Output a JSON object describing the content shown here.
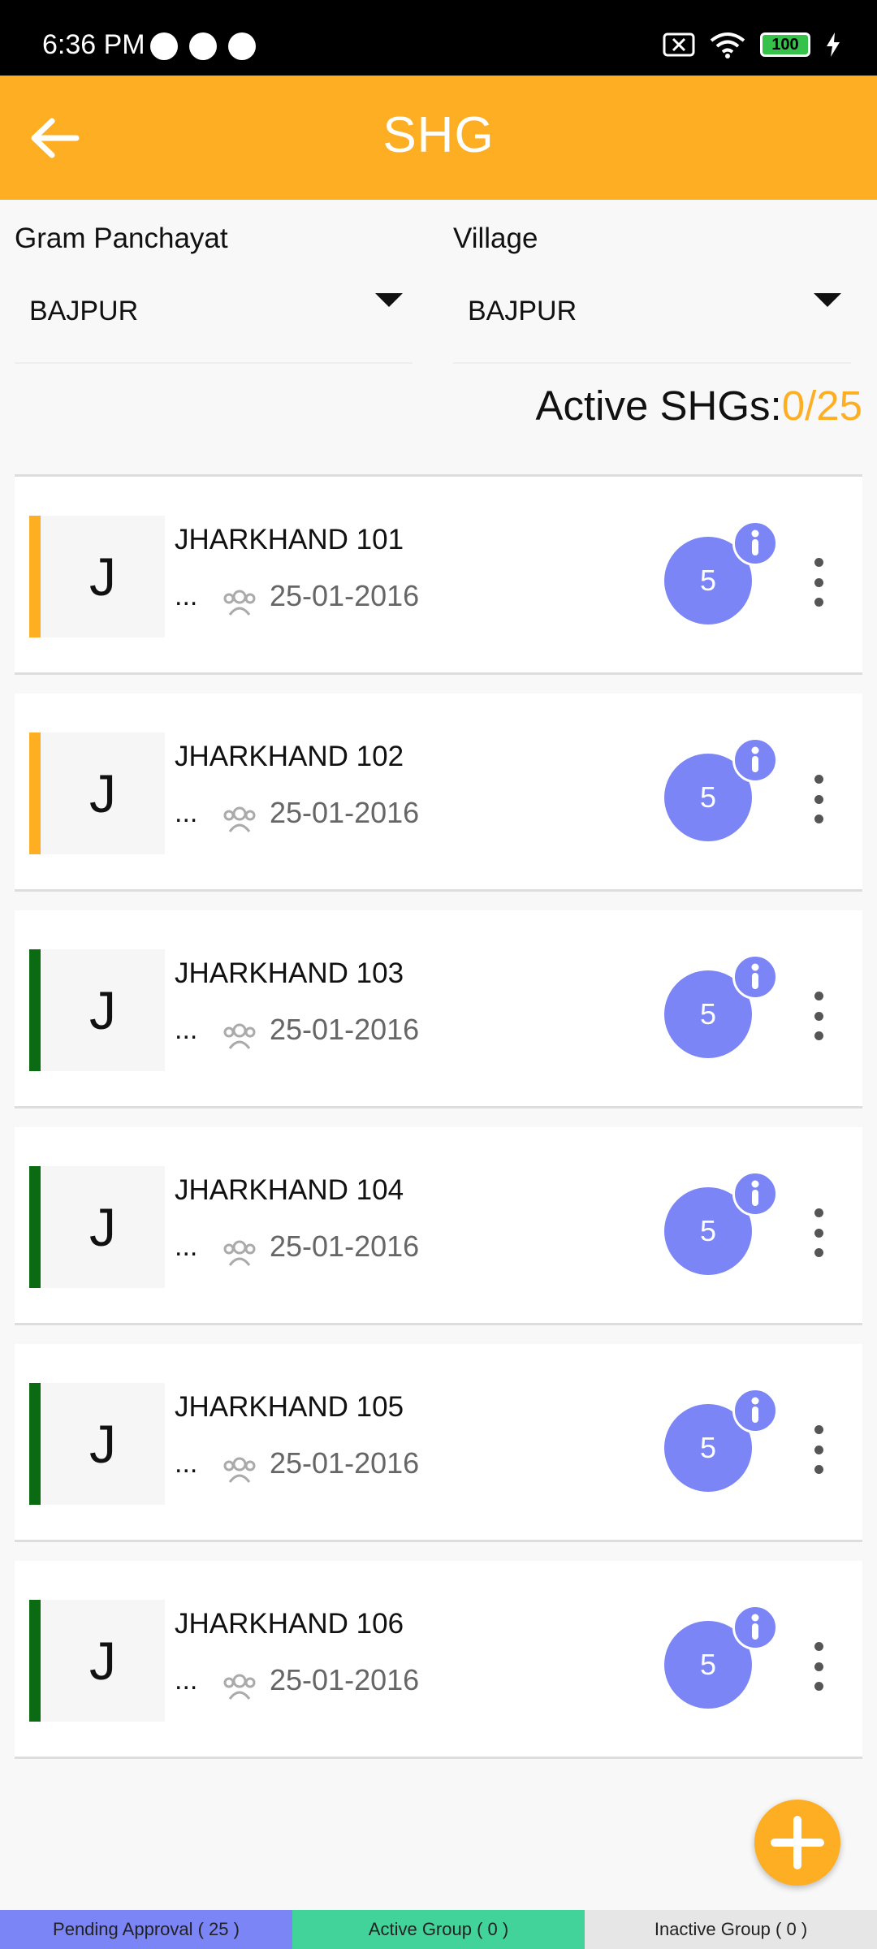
{
  "status": {
    "time": "6:36 PM",
    "battery": "100"
  },
  "appbar": {
    "title": "SHG"
  },
  "filters": [
    {
      "label": "Gram Panchayat",
      "value": "BAJPUR"
    },
    {
      "label": "Village",
      "value": "BAJPUR"
    }
  ],
  "active": {
    "label": "Active SHGs:",
    "value": "0/25"
  },
  "groups": [
    {
      "initial": "J",
      "name": "JHARKHAND 101",
      "ellipsis": "...",
      "date": "25-01-2016",
      "members": "5",
      "status_color": "#fdae23"
    },
    {
      "initial": "J",
      "name": "JHARKHAND 102",
      "ellipsis": "...",
      "date": "25-01-2016",
      "members": "5",
      "status_color": "#fdae23"
    },
    {
      "initial": "J",
      "name": "JHARKHAND 103",
      "ellipsis": "...",
      "date": "25-01-2016",
      "members": "5",
      "status_color": "#0b6b12"
    },
    {
      "initial": "J",
      "name": "JHARKHAND 104",
      "ellipsis": "...",
      "date": "25-01-2016",
      "members": "5",
      "status_color": "#0b6b12"
    },
    {
      "initial": "J",
      "name": "JHARKHAND 105",
      "ellipsis": "...",
      "date": "25-01-2016",
      "members": "5",
      "status_color": "#0b6b12"
    },
    {
      "initial": "J",
      "name": "JHARKHAND 106",
      "ellipsis": "...",
      "date": "25-01-2016",
      "members": "5",
      "status_color": "#0b6b12"
    }
  ],
  "bottom_tabs": [
    {
      "label": "Pending Approval ( 25 )",
      "color": "#7b85f6"
    },
    {
      "label": "Active Group ( 0 )",
      "color": "#42d39a"
    },
    {
      "label": "Inactive Group ( 0 )",
      "color": "#e6e6e6"
    }
  ],
  "colors": {
    "accent": "#fdae23",
    "badge": "#7b85f6"
  },
  "icons": {
    "back": "arrow-left",
    "members": "people",
    "info": "info",
    "menu": "more-vertical",
    "fab": "plus"
  }
}
